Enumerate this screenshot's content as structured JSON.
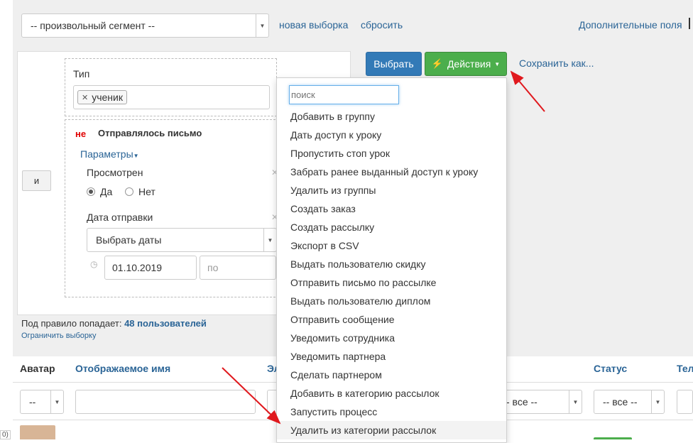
{
  "colors": {
    "primary": "#337ab7",
    "success": "#4cae4c",
    "link": "#2a6496",
    "danger": "#e00000",
    "arrow": "#e0191e"
  },
  "top": {
    "segment_select": "-- произвольный сегмент --",
    "new_selection": "новая выборка",
    "reset": "сбросить",
    "extra_fields": "Дополнительные поля"
  },
  "actions": {
    "select_button": "Выбрать",
    "actions_button": "Действия",
    "save_as": "Сохранить как..."
  },
  "filter": {
    "and_button": "и",
    "type_label": "Тип",
    "type_tag": "ученик",
    "not_label": "не",
    "condition_title": "Отправлялось письмо",
    "params_link": "Параметры",
    "viewed_label": "Просмотрен",
    "yes_label": "Да",
    "no_label": "Нет",
    "viewed_value": "Да",
    "send_date_label": "Дата отправки",
    "date_select": "Выбрать даты",
    "date_from": "01.10.2019",
    "date_to_placeholder": "по"
  },
  "summary": {
    "rule_text": "Под правило попадает:",
    "rule_count": "48 пользователей",
    "limit_link": "Ограничить выборку"
  },
  "table": {
    "headers": [
      "Аватар",
      "Отображаемое имя",
      "Эл",
      "Статус",
      "Тел"
    ],
    "filter_all_1": "--",
    "filter_all_2": "- все --",
    "filter_all_3": "-- все --",
    "edge_text": "0)"
  },
  "dropdown": {
    "search_placeholder": "поиск",
    "items": [
      "Добавить в группу",
      "Дать доступ к уроку",
      "Пропустить стоп урок",
      "Забрать ранее выданный доступ к уроку",
      "Удалить из группы",
      "Создать заказ",
      "Создать рассылку",
      "Экспорт в CSV",
      "Выдать пользователю скидку",
      "Отправить письмо по рассылке",
      "Выдать пользователю диплом",
      "Отправить сообщение",
      "Уведомить сотрудника",
      "Уведомить партнера",
      "Сделать партнером",
      "Добавить в категорию рассылок",
      "Запустить процесс",
      "Удалить из категории рассылок"
    ],
    "highlighted_index": 17
  }
}
